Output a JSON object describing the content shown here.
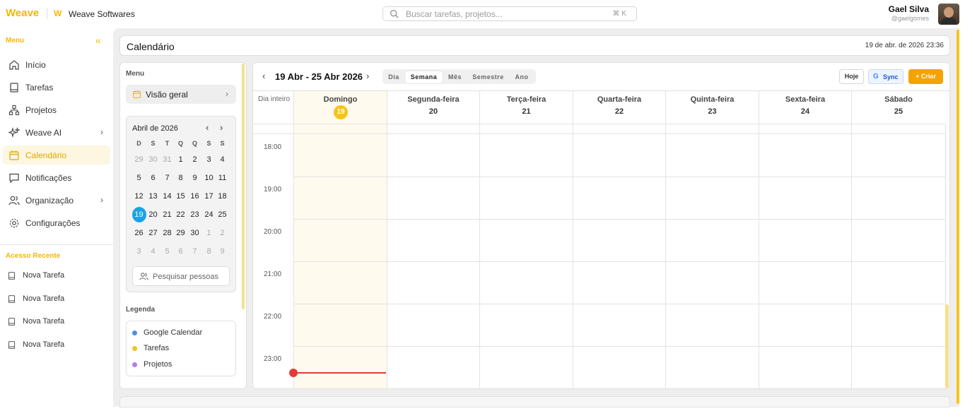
{
  "app": {
    "brand": "Weave",
    "org_logo": "W",
    "org_name": "Weave Softwares"
  },
  "search": {
    "placeholder": "Buscar tarefas, projetos...",
    "shortcut": "⌘ K"
  },
  "user": {
    "name": "Gael Silva",
    "handle": "@gaelgomes"
  },
  "sidebar": {
    "title": "Menu",
    "items": [
      {
        "label": "Início",
        "icon": "home-icon",
        "active": false,
        "chevron": false
      },
      {
        "label": "Tarefas",
        "icon": "book-icon",
        "active": false,
        "chevron": false
      },
      {
        "label": "Projetos",
        "icon": "network-icon",
        "active": false,
        "chevron": false
      },
      {
        "label": "Weave AI",
        "icon": "sparkles-icon",
        "active": false,
        "chevron": true
      },
      {
        "label": "Calendário",
        "icon": "calendar-icon",
        "active": true,
        "chevron": false
      },
      {
        "label": "Notificações",
        "icon": "message-icon",
        "active": false,
        "chevron": false
      },
      {
        "label": "Organização",
        "icon": "users-icon",
        "active": false,
        "chevron": true
      },
      {
        "label": "Configurações",
        "icon": "gear-icon",
        "active": false,
        "chevron": false
      }
    ],
    "recent_title": "Acesso Recente",
    "recent": [
      "Nova Tarefa",
      "Nova Tarefa",
      "Nova Tarefa",
      "Nova Tarefa"
    ]
  },
  "page": {
    "title": "Calendário",
    "datetime": "19 de abr. de 2026 23:36"
  },
  "left_panel": {
    "menu_title": "Menu",
    "overview_label": "Visão geral",
    "mini_calendar": {
      "title": "Abril de 2026",
      "weekdays": [
        "D",
        "S",
        "T",
        "Q",
        "Q",
        "S",
        "S"
      ],
      "weeks": [
        [
          "29",
          "30",
          "31",
          "1",
          "2",
          "3",
          "4"
        ],
        [
          "5",
          "6",
          "7",
          "8",
          "9",
          "10",
          "11"
        ],
        [
          "12",
          "13",
          "14",
          "15",
          "16",
          "17",
          "18"
        ],
        [
          "19",
          "20",
          "21",
          "22",
          "23",
          "24",
          "25"
        ],
        [
          "26",
          "27",
          "28",
          "29",
          "30",
          "1",
          "2"
        ],
        [
          "3",
          "4",
          "5",
          "6",
          "7",
          "8",
          "9"
        ]
      ],
      "selected": "19"
    },
    "people_placeholder": "Pesquisar pessoas",
    "legend_title": "Legenda",
    "legend": [
      {
        "label": "Google Calendar",
        "color": "#4a90e2"
      },
      {
        "label": "Tarefas",
        "color": "#f5c518"
      },
      {
        "label": "Projetos",
        "color": "#b57ce8"
      }
    ]
  },
  "calendar": {
    "range": "19 Abr - 25 Abr 2026",
    "views": [
      "Dia",
      "Semana",
      "Mês",
      "Semestre",
      "Ano"
    ],
    "active_view": "Semana",
    "buttons": {
      "today": "Hoje",
      "sync": "Sync",
      "create": "+ Criar"
    },
    "all_day_label": "Dia inteiro",
    "days": [
      {
        "name": "Domingo",
        "date": "19",
        "today": true
      },
      {
        "name": "Segunda-feira",
        "date": "20",
        "today": false
      },
      {
        "name": "Terça-feira",
        "date": "21",
        "today": false
      },
      {
        "name": "Quarta-feira",
        "date": "22",
        "today": false
      },
      {
        "name": "Quinta-feira",
        "date": "23",
        "today": false
      },
      {
        "name": "Sexta-feira",
        "date": "24",
        "today": false
      },
      {
        "name": "Sábado",
        "date": "25",
        "today": false
      }
    ],
    "hours": [
      "18:00",
      "19:00",
      "20:00",
      "21:00",
      "22:00",
      "23:00"
    ]
  }
}
